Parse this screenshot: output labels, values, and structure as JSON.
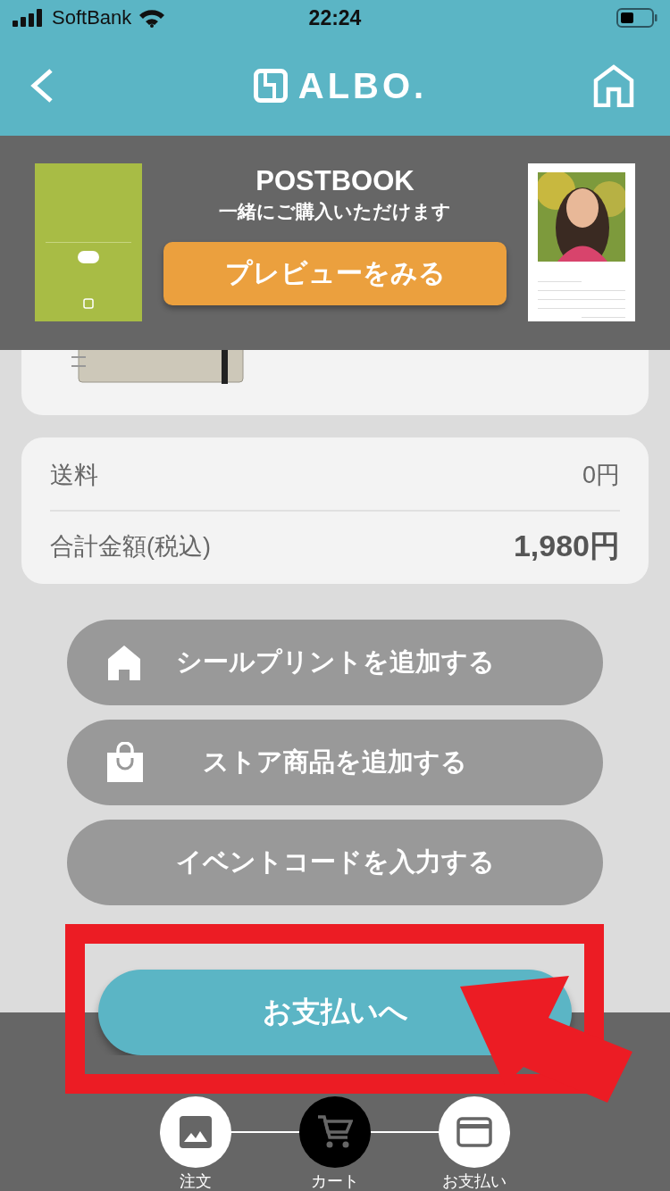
{
  "status_bar": {
    "carrier": "SoftBank",
    "time": "22:24"
  },
  "header": {
    "logo": "ALBO."
  },
  "promo": {
    "title": "POSTBOOK",
    "subtitle": "一緒にご購入いただけます",
    "button": "プレビューをみる"
  },
  "summary": [
    {
      "label": "送料",
      "value": "0円",
      "kind": "normal"
    },
    {
      "label": "合計金額(税込)",
      "value": "1,980円",
      "kind": "total"
    }
  ],
  "actions": [
    {
      "label": "シールプリントを追加する",
      "kind": "sticker"
    },
    {
      "label": "ストア商品を追加する",
      "kind": "store"
    },
    {
      "label": "イベントコードを入力する",
      "kind": "plain"
    }
  ],
  "pay_button": "お支払いへ",
  "steps": [
    {
      "label": "注文",
      "selected": false
    },
    {
      "label": "カート",
      "kind": "cart",
      "selected": true
    },
    {
      "label": "お支払い",
      "kind": "card",
      "selected": false
    }
  ]
}
